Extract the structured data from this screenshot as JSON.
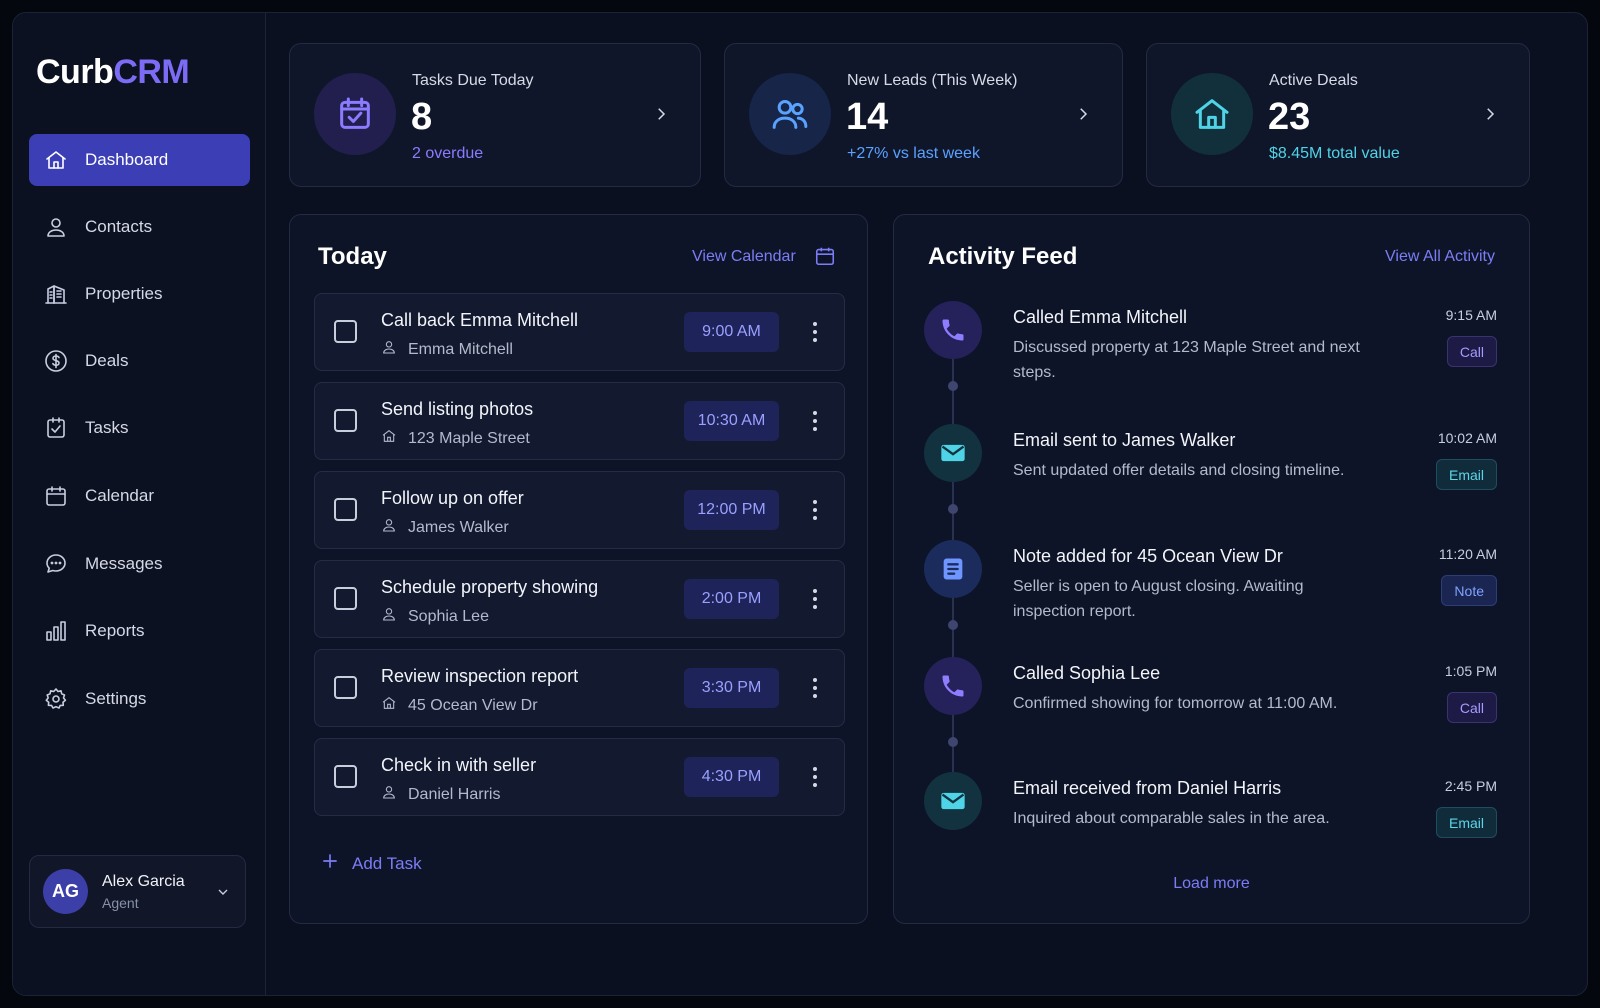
{
  "app": {
    "logo_part1": "Curb",
    "logo_part2": "CRM"
  },
  "sidebar": {
    "items": [
      {
        "label": "Dashboard",
        "icon": "home-icon",
        "active": true
      },
      {
        "label": "Contacts",
        "icon": "user-icon"
      },
      {
        "label": "Properties",
        "icon": "building-icon"
      },
      {
        "label": "Deals",
        "icon": "dollar-icon"
      },
      {
        "label": "Tasks",
        "icon": "clipboard-check-icon"
      },
      {
        "label": "Calendar",
        "icon": "calendar-icon"
      },
      {
        "label": "Messages",
        "icon": "chat-icon"
      },
      {
        "label": "Reports",
        "icon": "bar-chart-icon"
      },
      {
        "label": "Settings",
        "icon": "gear-icon"
      }
    ],
    "user": {
      "initials": "AG",
      "name": "Alex Garcia",
      "role": "Agent"
    }
  },
  "stats": [
    {
      "label": "Tasks Due Today",
      "value": "8",
      "sub": "2 overdue",
      "icon": "calendar-check-icon",
      "accent": "#8b7bff"
    },
    {
      "label": "New Leads (This Week)",
      "value": "14",
      "sub": "+27% vs last week",
      "icon": "users-icon",
      "accent": "#5aa2ff"
    },
    {
      "label": "Active Deals",
      "value": "23",
      "sub": "$8.45M total value",
      "icon": "house-icon",
      "accent": "#4fd3e6"
    }
  ],
  "today": {
    "title": "Today",
    "view_calendar": "View Calendar",
    "tasks": [
      {
        "title": "Call back Emma Mitchell",
        "sub": "Emma Mitchell",
        "sub_icon": "user-icon",
        "time": "9:00 AM"
      },
      {
        "title": "Send listing photos",
        "sub": "123 Maple Street",
        "sub_icon": "home-icon",
        "time": "10:30 AM"
      },
      {
        "title": "Follow up on offer",
        "sub": "James Walker",
        "sub_icon": "user-icon",
        "time": "12:00 PM"
      },
      {
        "title": "Schedule property showing",
        "sub": "Sophia Lee",
        "sub_icon": "user-icon",
        "time": "2:00 PM"
      },
      {
        "title": "Review inspection report",
        "sub": "45 Ocean View Dr",
        "sub_icon": "home-icon",
        "time": "3:30 PM"
      },
      {
        "title": "Check in with seller",
        "sub": "Daniel Harris",
        "sub_icon": "user-icon",
        "time": "4:30 PM"
      }
    ],
    "add_task": "Add Task"
  },
  "activity": {
    "title": "Activity Feed",
    "view_all": "View All Activity",
    "items": [
      {
        "type": "call",
        "title": "Called Emma Mitchell",
        "desc": "Discussed property at 123 Maple Street and next steps.",
        "time": "9:15 AM",
        "tag": "Call"
      },
      {
        "type": "email",
        "title": "Email sent to James Walker",
        "desc": "Sent updated offer details and closing timeline.",
        "time": "10:02 AM",
        "tag": "Email"
      },
      {
        "type": "note",
        "title": "Note added for 45 Ocean View Dr",
        "desc": "Seller is open to August closing. Awaiting inspection report.",
        "time": "11:20 AM",
        "tag": "Note"
      },
      {
        "type": "call",
        "title": "Called Sophia Lee",
        "desc": "Confirmed showing for tomorrow at 11:00 AM.",
        "time": "1:05 PM",
        "tag": "Call"
      },
      {
        "type": "email",
        "title": "Email received from Daniel Harris",
        "desc": "Inquired about comparable sales in the area.",
        "time": "2:45 PM",
        "tag": "Email"
      }
    ],
    "load_more": "Load more"
  }
}
